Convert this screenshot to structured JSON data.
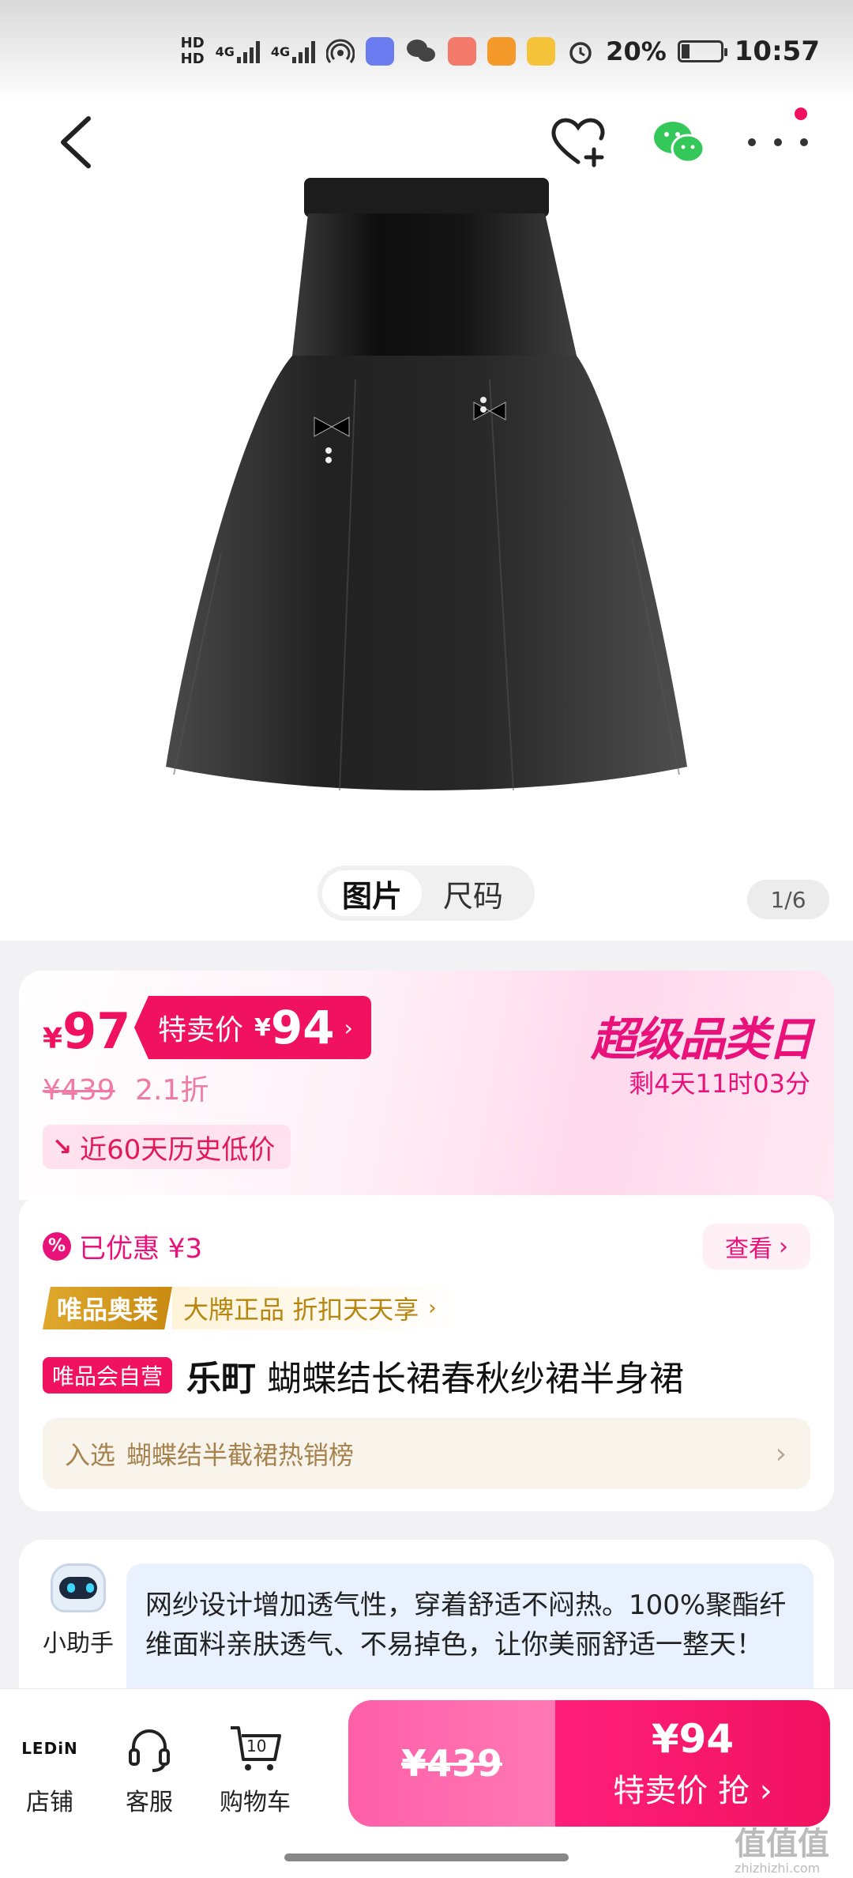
{
  "status_bar": {
    "hd1": "HD",
    "hd2": "HD",
    "net1": "4G",
    "net2": "4G",
    "battery_pct": "20%",
    "time": "10:57"
  },
  "nav": {
    "back_icon": "chevron-left-icon",
    "favorite_icon": "heart-plus-icon",
    "share_icon": "wechat-icon",
    "more_icon": "more-icon"
  },
  "gallery": {
    "tabs": [
      "图片",
      "尺码"
    ],
    "active_tab": "图片",
    "pager": "1/6"
  },
  "price": {
    "currency": "¥",
    "current": "97",
    "special_label": "特卖价",
    "special_price": "94",
    "original": "¥439",
    "discount": "2.1折",
    "history_low": "近60天历史低价",
    "event_title": "超级品类日",
    "countdown": "剩4天11时03分"
  },
  "info": {
    "coupon_text": "已优惠 ¥3",
    "view_label": "查看",
    "outlet_tag": "唯品奥莱",
    "outlet_text": "大牌正品 折扣天天享",
    "self_tag": "唯品会自营",
    "brand": "乐町",
    "product_name": "蝴蝶结长裙春秋纱裙半身裙",
    "ranking_prefix": "入选",
    "ranking_text": "蝴蝶结半截裙热销榜"
  },
  "assistant": {
    "label": "小助手",
    "message": "网纱设计增加透气性，穿着舒适不闷热。100%聚酯纤维面料亲肤透气、不易掉色，让你美丽舒适一整天！"
  },
  "bottom_bar": {
    "store_logo": "LEDiN",
    "store_label": "店铺",
    "service_label": "客服",
    "cart_label": "购物车",
    "cart_count": "10",
    "buy_original": "¥439",
    "buy_price": "¥94",
    "buy_cta": "特卖价 抢 ›"
  },
  "watermark": {
    "text": "值值值",
    "sub": "zhizhizhi.com"
  },
  "colors": {
    "accent": "#f0125f",
    "gold": "#c98a10"
  }
}
